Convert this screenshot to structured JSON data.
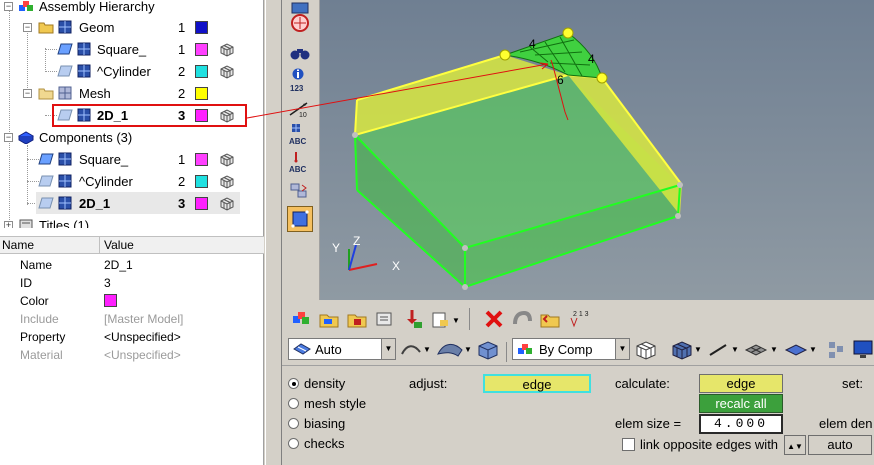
{
  "tree": {
    "assembly_label": "Assembly Hierarchy",
    "geom_label": "Geom",
    "geom_count": "1",
    "square_label": "Square_",
    "square_count": "1",
    "cylinder_label": "^Cylinder",
    "cylinder_count": "2",
    "mesh_label": "Mesh",
    "mesh_count": "2",
    "mesh_2d_label": "2D_1",
    "mesh_2d_count": "3",
    "components_label": "Components (3)",
    "comp_square_label": "Square_",
    "comp_square_count": "1",
    "comp_cylinder_label": "^Cylinder",
    "comp_cylinder_count": "2",
    "comp_2d_label": "2D_1",
    "comp_2d_count": "3",
    "titles_label": "Titles (1)"
  },
  "colors": {
    "geom": "#1010c8",
    "square": "#ff40ff",
    "cylinder": "#20e0e0",
    "mesh": "#ffff00",
    "mesh_2d": "#ff20ff",
    "accent_red": "#e01010",
    "highlight_yellow": "#e6e66a",
    "recalc_green": "#3ca03c",
    "mesh_green": "#4ed84e",
    "edge_yellow": "#ffff40"
  },
  "props": {
    "col_name": "Name",
    "col_value": "Value",
    "rows": [
      {
        "key": "Name",
        "value": "2D_1"
      },
      {
        "key": "ID",
        "value": "3"
      },
      {
        "key": "Color",
        "value": ""
      },
      {
        "key": "Include",
        "value": "[Master Model]"
      },
      {
        "key": "Property",
        "value": "<Unspecified>"
      },
      {
        "key": "Material",
        "value": "<Unspecified>"
      }
    ]
  },
  "viewport": {
    "edge_labels": [
      "4",
      "4",
      "6"
    ],
    "axis_x": "X",
    "axis_y": "Y",
    "axis_z": "Z"
  },
  "vtool": {
    "ids_label": "123",
    "abc_label": "ABC",
    "abc_label_2": "ABC",
    "tol_label": "10"
  },
  "toolbar2": {
    "mesh_mode": "Auto",
    "color_mode": "By Comp"
  },
  "form": {
    "radio_density": "density",
    "radio_mesh_style": "mesh style",
    "radio_biasing": "biasing",
    "radio_checks": "checks",
    "adjust_label": "adjust:",
    "adjust_value": "edge",
    "calculate_label": "calculate:",
    "calculate_value": "edge",
    "recalc_label": "recalc all",
    "set_label": "set:",
    "elem_size_label": "elem size =",
    "elem_size_value": "4.000",
    "elem_density_label": "elem den",
    "link_edges_label": "link opposite edges with",
    "auto_label": "auto"
  },
  "toolbar1": {
    "renumber_digits": "2 1 3"
  }
}
